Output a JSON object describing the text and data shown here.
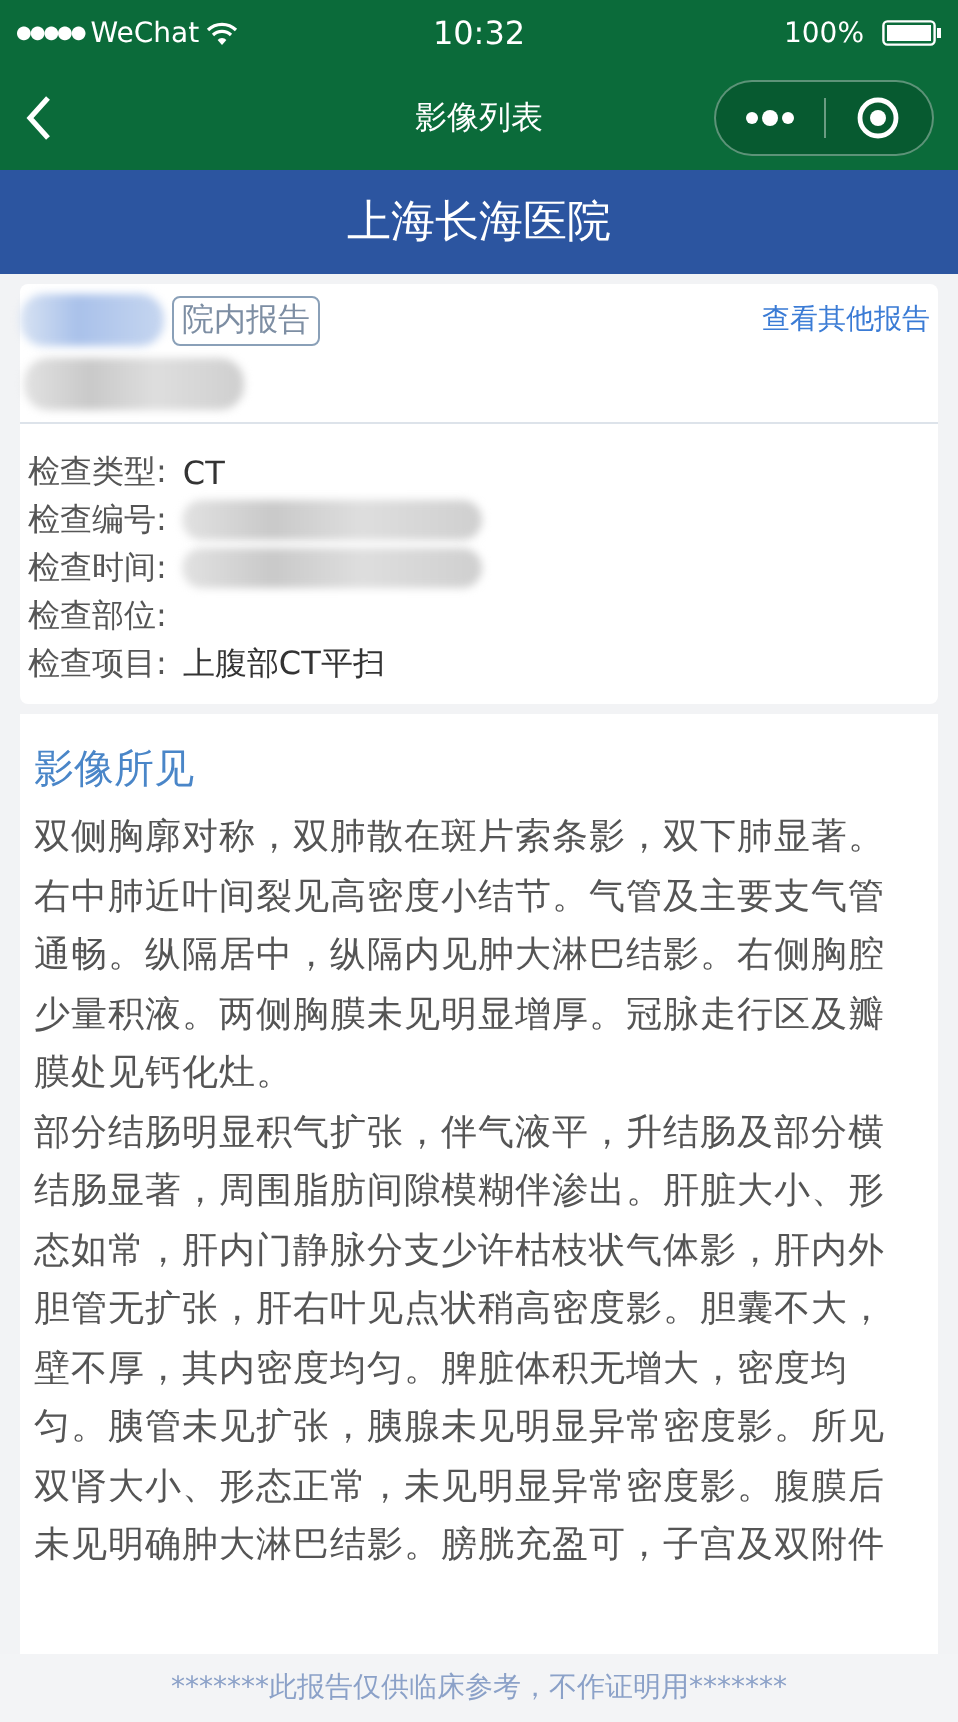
{
  "status_bar": {
    "signal": "●●●●●",
    "carrier": "WeChat",
    "time": "10:32",
    "battery": "100%"
  },
  "nav": {
    "title": "影像列表"
  },
  "hospital": {
    "name": "上海长海医院"
  },
  "report": {
    "tag": "院内报告",
    "link": "查看其他报告",
    "fields": [
      {
        "label": "检查类型:",
        "value": "CT",
        "redacted": false
      },
      {
        "label": "检查编号:",
        "redacted": true
      },
      {
        "label": "检查时间:",
        "redacted": true
      },
      {
        "label": "检查部位:",
        "redacted": false
      },
      {
        "label": "检查项目:",
        "value": "上腹部CT平扫",
        "redacted": false
      }
    ]
  },
  "findings": {
    "title": "影像所见",
    "paragraphs": [
      "双侧胸廓对称，双肺散在斑片索条影，双下肺显著。右中肺近叶间裂见高密度小结节。气管及主要支气管通畅。纵隔居中，纵隔内见肿大淋巴结影。右侧胸腔少量积液。两侧胸膜未见明显增厚。冠脉走行区及瓣膜处见钙化灶。",
      "部分结肠明显积气扩张，伴气液平，升结肠及部分横结肠显著，周围脂肪间隙模糊伴渗出。肝脏大小、形态如常，肝内门静脉分支少许枯枝状气体影，肝内外胆管无扩张，肝右叶见点状稍高密度影。胆囊不大，壁不厚，其内密度均匀。脾脏体积无增大，密度均匀。胰管未见扩张，胰腺未见明显异常密度影。所见双肾大小、形态正常，未见明显异常密度影。腹膜后未见明确肿大淋巴结影。膀胱充盈可，子宫及双附件"
    ]
  },
  "footer": {
    "notice": "*******此报告仅供临床参考，不作证明用*******"
  }
}
